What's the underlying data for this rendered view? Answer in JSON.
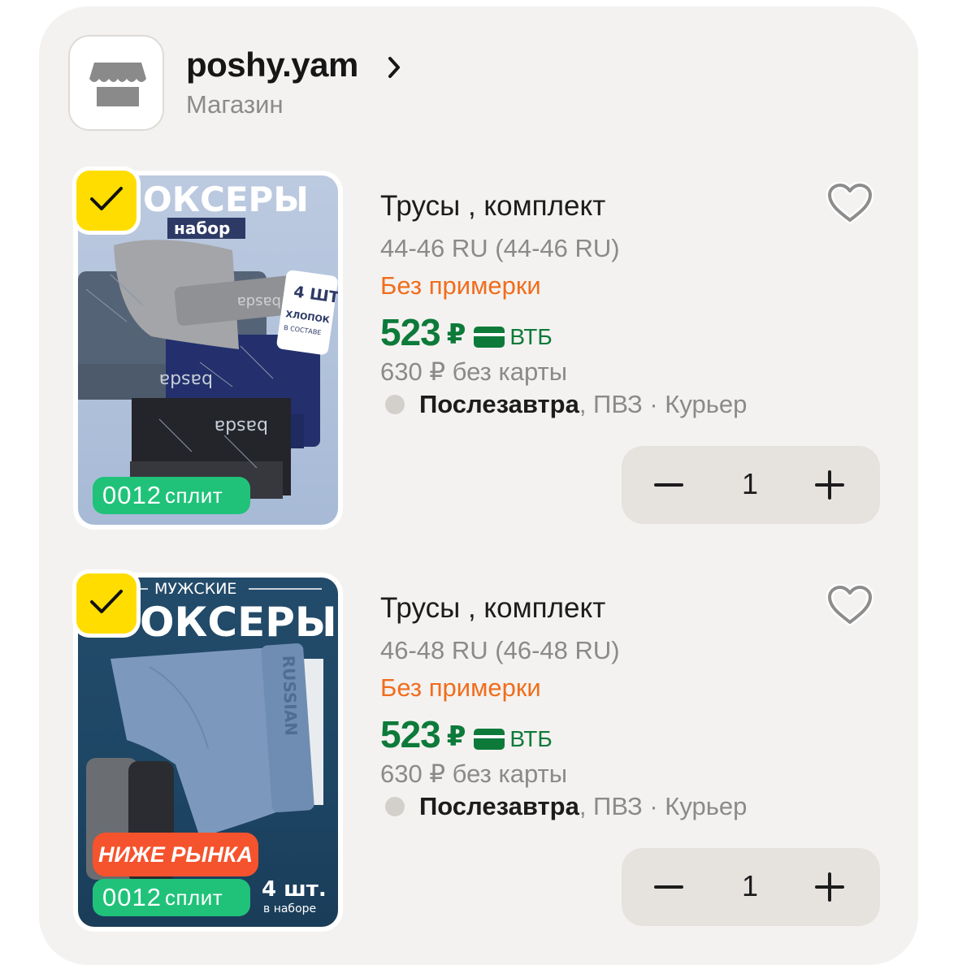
{
  "store": {
    "name": "poshy.yam",
    "subtitle": "Магазин",
    "logo_icon": "storefront-icon",
    "chevron_icon": "chevron-right-icon"
  },
  "items": [
    {
      "title": "Трусы , комплект",
      "size": "44-46 RU (44-46 RU)",
      "fit_note": "Без примерки",
      "price": "523",
      "currency": "₽",
      "bank": "ВТБ",
      "old_price": "630 ₽  без карты",
      "delivery_day": "Послезавтра",
      "delivery_rest": ", ПВЗ · Курьер",
      "quantity": "1",
      "selected": true,
      "split_num": "0012",
      "split_text": "сплит",
      "image_text": {
        "headline": "ОКСЕРЫ",
        "tag": "набор",
        "pack_count": "4 ШТ",
        "pack_material": "ХЛОПОК",
        "pack_note": "В СОСТАВЕ",
        "brand": "basda"
      }
    },
    {
      "title": "Трусы , комплект",
      "size": "46-48 RU (46-48 RU)",
      "fit_note": "Без примерки",
      "price": "523",
      "currency": "₽",
      "bank": "ВТБ",
      "old_price": "630 ₽  без карты",
      "delivery_day": "Послезавтра",
      "delivery_rest": ", ПВЗ · Курьер",
      "quantity": "1",
      "selected": true,
      "split_num": "0012",
      "split_text": "сплит",
      "promo": "НИЖЕ РЫНКА",
      "image_text": {
        "kicker": "МУЖСКИЕ",
        "headline": "ОКСЕРЫ",
        "band": "RUSSIAN",
        "count": "4 шт.",
        "count_note": "в наборе"
      }
    }
  ],
  "colors": {
    "price_green": "#0d7a3a",
    "fit_orange": "#f06d1c",
    "check_yellow": "#ffdd00",
    "split_green": "#20c27a",
    "promo_red": "#f5532d"
  }
}
